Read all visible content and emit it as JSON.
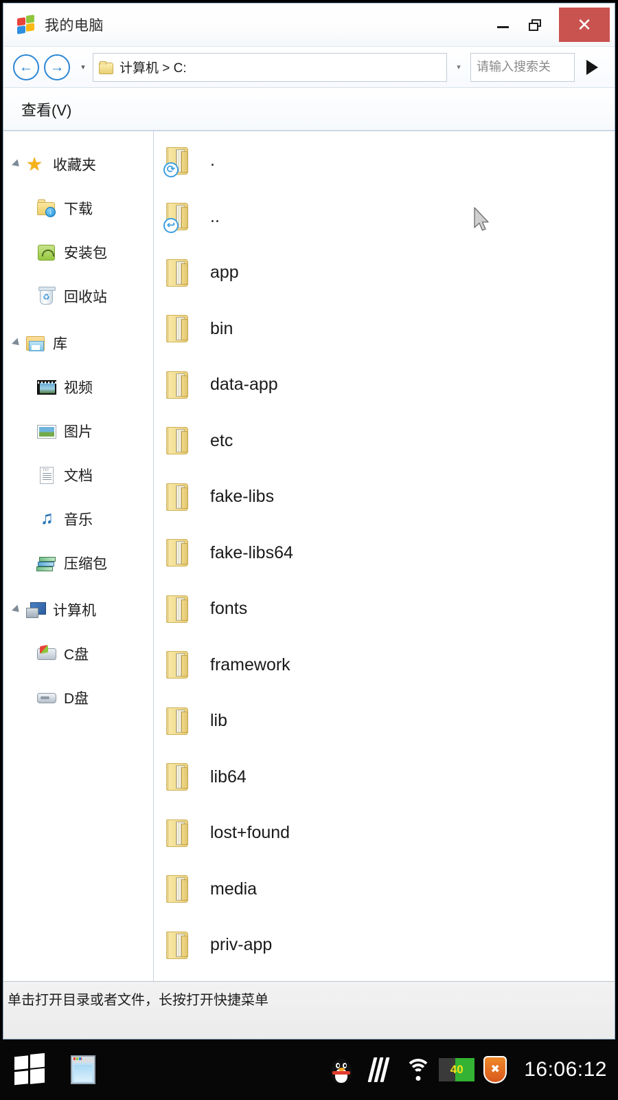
{
  "window": {
    "title": "我的电脑",
    "title_icon": "windows-flag-icon",
    "minimize_label": "–",
    "maximize_label": "□",
    "close_label": "✕"
  },
  "toolbar": {
    "back_label": "←",
    "forward_label": "→",
    "nav_history_caret": "▾",
    "path_caret": "▾",
    "path_text": "计算机 > C:",
    "search_placeholder": "请输入搜索关",
    "search_value": "",
    "go_label": "▶"
  },
  "menubar": {
    "items": [
      {
        "label": "查看(V)"
      }
    ]
  },
  "sidebar": {
    "groups": [
      {
        "name": "收藏夹",
        "icon": "star-icon",
        "expanded": true,
        "children": [
          {
            "label": "下载",
            "icon": "download-folder-icon"
          },
          {
            "label": "安装包",
            "icon": "apk-package-icon"
          },
          {
            "label": "回收站",
            "icon": "recycle-bin-icon"
          }
        ]
      },
      {
        "name": "库",
        "icon": "library-folder-icon",
        "expanded": true,
        "children": [
          {
            "label": "视频",
            "icon": "video-icon"
          },
          {
            "label": "图片",
            "icon": "picture-icon"
          },
          {
            "label": "文档",
            "icon": "document-icon"
          },
          {
            "label": "音乐",
            "icon": "music-icon"
          },
          {
            "label": "压缩包",
            "icon": "archive-icon"
          }
        ]
      },
      {
        "name": "计算机",
        "icon": "computer-icon",
        "expanded": true,
        "children": [
          {
            "label": "C盘",
            "icon": "c-drive-icon"
          },
          {
            "label": "D盘",
            "icon": "d-drive-icon"
          }
        ]
      }
    ]
  },
  "filelist": {
    "items": [
      {
        "name": ".",
        "icon": "folder-icon",
        "badge": "⟳",
        "badge_name": "refresh-badge-icon"
      },
      {
        "name": "..",
        "icon": "folder-icon",
        "badge": "↩",
        "badge_name": "parent-badge-icon"
      },
      {
        "name": "app",
        "icon": "folder-icon",
        "badge": "",
        "badge_name": ""
      },
      {
        "name": "bin",
        "icon": "folder-icon",
        "badge": "",
        "badge_name": ""
      },
      {
        "name": "data-app",
        "icon": "folder-icon",
        "badge": "",
        "badge_name": ""
      },
      {
        "name": "etc",
        "icon": "folder-icon",
        "badge": "",
        "badge_name": ""
      },
      {
        "name": "fake-libs",
        "icon": "folder-icon",
        "badge": "",
        "badge_name": ""
      },
      {
        "name": "fake-libs64",
        "icon": "folder-icon",
        "badge": "",
        "badge_name": ""
      },
      {
        "name": "fonts",
        "icon": "folder-icon",
        "badge": "",
        "badge_name": ""
      },
      {
        "name": "framework",
        "icon": "folder-icon",
        "badge": "",
        "badge_name": ""
      },
      {
        "name": "lib",
        "icon": "folder-icon",
        "badge": "",
        "badge_name": ""
      },
      {
        "name": "lib64",
        "icon": "folder-icon",
        "badge": "",
        "badge_name": ""
      },
      {
        "name": "lost+found",
        "icon": "folder-icon",
        "badge": "",
        "badge_name": ""
      },
      {
        "name": "media",
        "icon": "folder-icon",
        "badge": "",
        "badge_name": ""
      },
      {
        "name": "priv-app",
        "icon": "folder-icon",
        "badge": "",
        "badge_name": ""
      }
    ]
  },
  "statusbar": {
    "text": "单击打开目录或者文件，长按打开快捷菜单"
  },
  "taskbar": {
    "start_icon": "windows-start-icon",
    "window_icon": "explorer-window-icon",
    "tray": [
      {
        "name": "qq-icon"
      },
      {
        "name": "device-signal-icon"
      },
      {
        "name": "wifi-icon"
      },
      {
        "name": "battery-icon",
        "value": "40"
      },
      {
        "name": "security-shield-icon"
      }
    ],
    "clock": "16:06:12"
  },
  "colors": {
    "close_button": "#c9534f",
    "nav_accent": "#2b86d4",
    "battery_fill": "#33b233",
    "battery_text": "#f2e41b",
    "shield": "#e0741f",
    "taskbar_bg": "#070707"
  }
}
